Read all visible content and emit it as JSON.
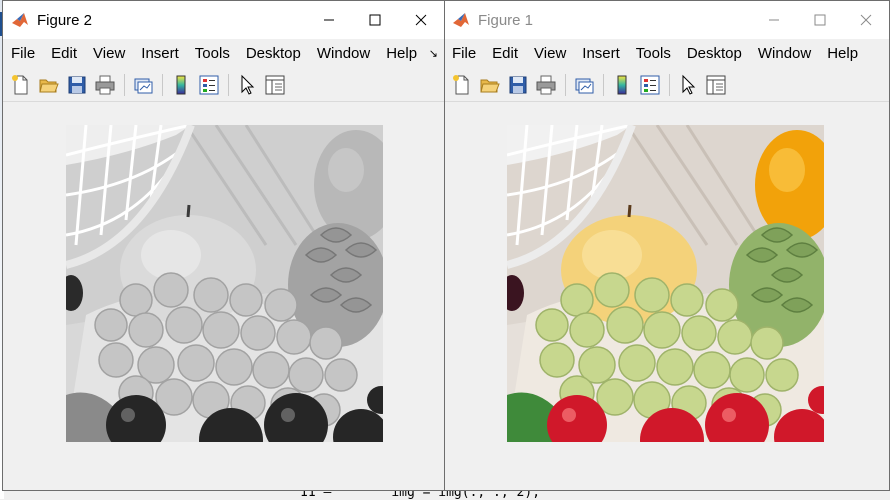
{
  "background": {
    "code_line_number": "11 —",
    "code_line_text": "img = img(:, :, 2);"
  },
  "windows": [
    {
      "id": "figure-2",
      "title": "Figure 2",
      "active": true,
      "menu": [
        "File",
        "Edit",
        "View",
        "Insert",
        "Tools",
        "Desktop",
        "Window",
        "Help"
      ],
      "image": "grayscale-fruit-photo"
    },
    {
      "id": "figure-1",
      "title": "Figure 1",
      "active": false,
      "menu": [
        "File",
        "Edit",
        "View",
        "Insert",
        "Tools",
        "Desktop",
        "Window",
        "Help"
      ],
      "image": "color-fruit-photo"
    }
  ],
  "toolbar_icons": [
    "new-figure-icon",
    "open-file-icon",
    "save-icon",
    "print-icon",
    "link-plot-icon",
    "colorbar-icon",
    "legend-icon",
    "edit-plot-arrow-icon",
    "property-inspector-icon"
  ],
  "colors": {
    "titlebar_active": "#ffffff",
    "window_bg": "#f0f0f0",
    "matlab_orange": "#e16737"
  }
}
